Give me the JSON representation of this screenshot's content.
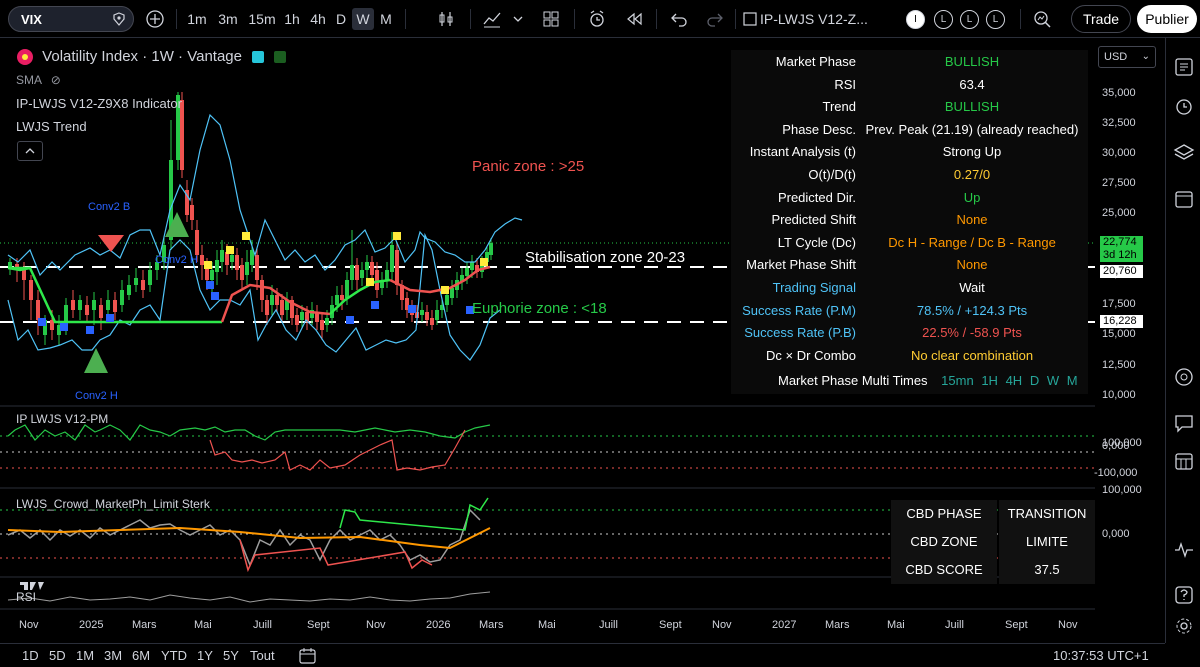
{
  "toolbar": {
    "symbol": "VIX",
    "intervals": [
      "1m",
      "3m",
      "15m",
      "1h",
      "4h",
      "D",
      "W",
      "M"
    ],
    "active_interval": "W",
    "indicator_name": "IP-LWJS V12-Z...",
    "alert_badges": [
      "I",
      "L",
      "L",
      "L"
    ],
    "trade_label": "Trade",
    "publish_label": "Publier"
  },
  "legend": {
    "title": "Volatility Index · 1W · Vantage",
    "sma": "SMA",
    "indicator": "IP-LWJS V12-Z9X8 Indicator",
    "trend": "LWJS Trend"
  },
  "price_scale": {
    "currency": "USD",
    "labels": [
      "35,000",
      "32,500",
      "30,000",
      "27,500",
      "25,000",
      "20,000",
      "17,500",
      "15,000",
      "12,500",
      "10,000"
    ],
    "tags": [
      {
        "value": "22,774",
        "sub": "3d 12h",
        "color": "#26c948"
      },
      {
        "value": "20,760",
        "sub": "",
        "color": "#ffffff"
      },
      {
        "value": "16,228",
        "sub": "",
        "color": "#ffffff"
      }
    ],
    "pm_labels": [
      "100,000",
      "0,000",
      "-100,000"
    ],
    "crowd_labels": [
      "100,000",
      "0,000"
    ]
  },
  "info_table": [
    {
      "key": "Market Phase",
      "value": "BULLISH",
      "color": "#26c948",
      "key_color": "#ffffff"
    },
    {
      "key": "RSI",
      "value": "63.4",
      "color": "#ffffff",
      "key_color": "#ffffff"
    },
    {
      "key": "Trend",
      "value": "BULLISH",
      "color": "#26c948",
      "key_color": "#ffffff"
    },
    {
      "key": "Phase Desc.",
      "value": "Prev. Peak (21.19) (already reached)",
      "color": "#ffffff",
      "key_color": "#ffffff"
    },
    {
      "key": "Instant Analysis (t)",
      "value": "Strong Up",
      "color": "#ffffff",
      "key_color": "#ffffff"
    },
    {
      "key": "O(t)/D(t)",
      "value": "0.27/0",
      "color": "#ffcc33",
      "key_color": "#ffffff"
    },
    {
      "key": "Predicted Dir.",
      "value": "Up",
      "color": "#26c948",
      "key_color": "#ffffff"
    },
    {
      "key": "Predicted Shift",
      "value": "None",
      "color": "#ff9800",
      "key_color": "#ffffff"
    },
    {
      "key": "LT Cycle (Dc)",
      "value": "Dc H - Range / Dc B - Range",
      "color": "#ff9800",
      "key_color": "#ffffff"
    },
    {
      "key": "Market Phase Shift",
      "value": "None",
      "color": "#ff9800",
      "key_color": "#ffffff"
    },
    {
      "key": "Trading Signal",
      "value": "Wait",
      "color": "#ffffff",
      "key_color": "#4fc3f7"
    },
    {
      "key": "Success Rate (P.M)",
      "value": "78.5% / +124.3 Pts",
      "color": "#4fc3f7",
      "key_color": "#4fc3f7"
    },
    {
      "key": "Success Rate (P.B)",
      "value": "22.5% / -58.9 Pts",
      "color": "#ef5350",
      "key_color": "#4fc3f7"
    },
    {
      "key": "Dc × Dr Combo",
      "value": "No clear combination",
      "color": "#ffcc33",
      "key_color": "#ffffff"
    }
  ],
  "multi_times": {
    "label": "Market Phase Multi Times",
    "frames": [
      "15mn",
      "1H",
      "4H",
      "D",
      "W",
      "M"
    ]
  },
  "zones": {
    "panic": "Panic zone : >25",
    "stabilisation": "Stabilisation zone 20-23",
    "euphorie": "Euphorie zone : <18"
  },
  "signals": {
    "conv2_b": "Conv2 B",
    "conv2_h_mid": "Conv2 H",
    "conv2_h_low": "Conv2 H",
    "mb": "MB",
    "mh": "MH"
  },
  "panes": {
    "pm": "IP LWJS V12-PM",
    "crowd": "LWJS_Crowd_MarketPh_Limit Sterk",
    "rsi": "RSI"
  },
  "cbd_table": [
    {
      "key": "CBD PHASE",
      "value": "TRANSITION"
    },
    {
      "key": "CBD ZONE",
      "value": "LIMITE"
    },
    {
      "key": "CBD SCORE",
      "value": "37.5"
    }
  ],
  "time_axis": [
    "Nov",
    "2025",
    "Mars",
    "Mai",
    "Juill",
    "Sept",
    "Nov",
    "2026",
    "Mars",
    "Mai",
    "Juill",
    "Sept",
    "Nov",
    "2027",
    "Mars",
    "Mai",
    "Juill",
    "Sept",
    "Nov"
  ],
  "bottom_bar": {
    "ranges": [
      "1D",
      "5D",
      "1M",
      "3M",
      "6M",
      "YTD",
      "1Y",
      "5Y",
      "Tout"
    ],
    "clock": "10:37:53 UTC+1"
  },
  "colors": {
    "up": "#26c948",
    "down": "#ef5350",
    "bands": "#4fc3f7",
    "trend_green": "#2ee84a",
    "trend_red": "#ef5350"
  }
}
